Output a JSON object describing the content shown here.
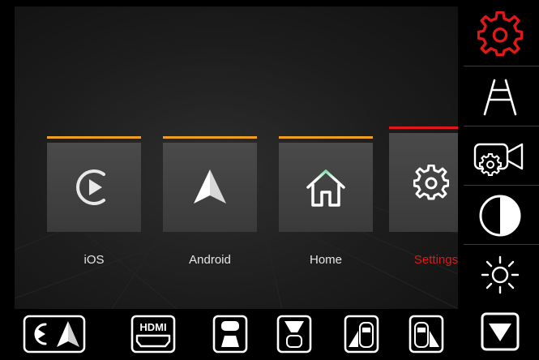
{
  "tiles": [
    {
      "label": "iOS",
      "icon": "carplay-icon",
      "accent": "#f0a020"
    },
    {
      "label": "Android",
      "icon": "android-auto-icon",
      "accent": "#f0a020"
    },
    {
      "label": "Home",
      "icon": "home-icon",
      "accent": "#f0a020"
    },
    {
      "label": "Settings",
      "icon": "settings-icon",
      "accent": "#e01818"
    }
  ],
  "sidebar": {
    "items": [
      {
        "icon": "gear-icon",
        "active": true
      },
      {
        "icon": "parking-lines-icon"
      },
      {
        "icon": "camera-settings-icon"
      },
      {
        "icon": "contrast-icon"
      },
      {
        "icon": "brightness-icon"
      },
      {
        "icon": "scroll-down-icon"
      }
    ]
  },
  "bottom_bar": {
    "items": [
      {
        "icon": "carplay-android-icon"
      },
      {
        "icon": "hdmi-icon",
        "label": "HDMI"
      },
      {
        "icon": "front-camera-icon"
      },
      {
        "icon": "front-rear-camera-icon"
      },
      {
        "icon": "left-camera-icon"
      },
      {
        "icon": "right-camera-icon"
      }
    ]
  },
  "colors": {
    "accent_orange": "#f0a020",
    "accent_red": "#e01818",
    "icon_white": "#ffffff"
  }
}
